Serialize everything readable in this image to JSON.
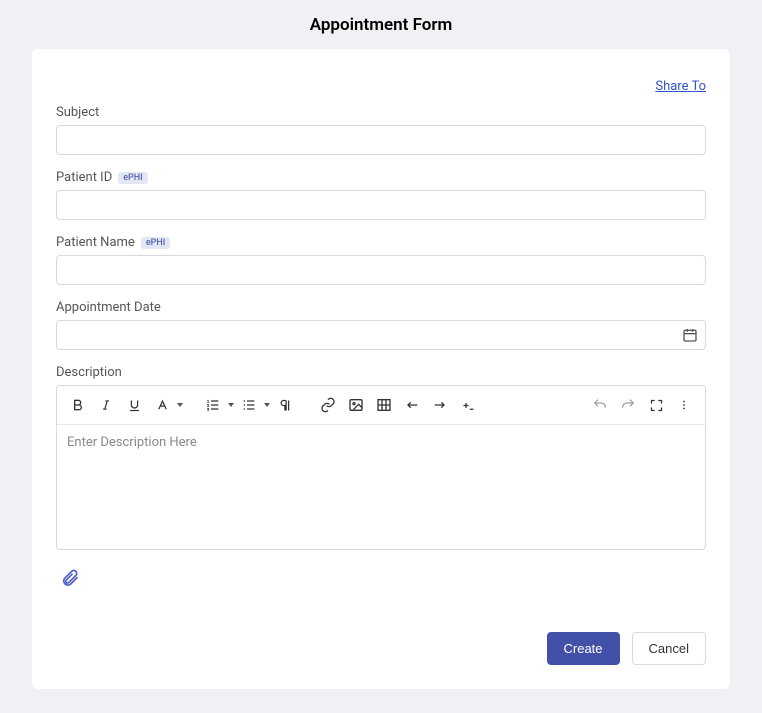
{
  "page": {
    "title": "Appointment Form"
  },
  "links": {
    "share": "Share To"
  },
  "fields": {
    "subject": {
      "label": "Subject",
      "value": ""
    },
    "patient_id": {
      "label": "Patient ID",
      "badge": "ePHI",
      "value": ""
    },
    "patient_name": {
      "label": "Patient Name",
      "badge": "ePHI",
      "value": ""
    },
    "appointment_date": {
      "label": "Appointment Date",
      "value": ""
    },
    "description": {
      "label": "Description",
      "placeholder": "Enter Description Here",
      "value": ""
    }
  },
  "buttons": {
    "create": "Create",
    "cancel": "Cancel"
  }
}
